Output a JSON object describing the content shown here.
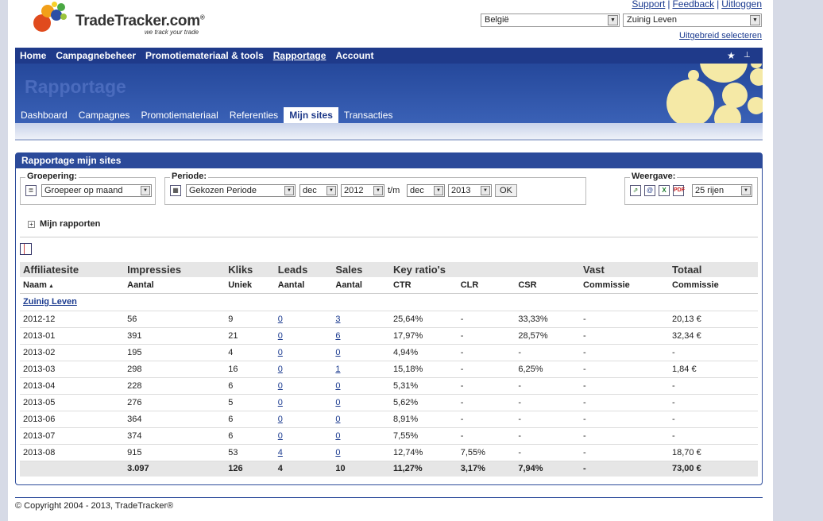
{
  "header": {
    "brand": "TradeTracker.com",
    "registered": "®",
    "tagline": "we track your trade",
    "links": [
      "Support",
      "Feedback",
      "Uitloggen"
    ],
    "country": "België",
    "site": "Zuinig Leven",
    "advanced": "Uitgebreid selecteren"
  },
  "nav": {
    "main": [
      "Home",
      "Campagnebeheer",
      "Promotiemateriaal & tools",
      "Rapportage",
      "Account"
    ],
    "active": "Rapportage",
    "banner_title": "Rapportage",
    "sub": [
      "Dashboard",
      "Campagnes",
      "Promotiemateriaal",
      "Referenties",
      "Mijn sites",
      "Transacties"
    ],
    "sub_active": "Mijn sites"
  },
  "panel": {
    "title": "Rapportage mijn sites",
    "grouping_label": "Groepering:",
    "grouping_value": "Groepeer op maand",
    "period_label": "Periode:",
    "period_value": "Gekozen Periode",
    "from_month": "dec",
    "from_year": "2012",
    "to_label": "t/m",
    "to_month": "dec",
    "to_year": "2013",
    "ok": "OK",
    "view_label": "Weergave:",
    "rows_value": "25 rijen",
    "my_reports": "Mijn rapporten"
  },
  "table": {
    "groups": [
      "Affiliatesite",
      "Impressies",
      "Kliks",
      "Leads",
      "Sales",
      "Key ratio's",
      "",
      "",
      "Vast",
      "Totaal"
    ],
    "columns": [
      "Naam",
      "Aantal",
      "Uniek",
      "Aantal",
      "Aantal",
      "CTR",
      "CLR",
      "CSR",
      "Commissie",
      "Commissie"
    ],
    "sort_mark": "▲",
    "group_name": "Zuinig Leven",
    "rows": [
      [
        "2012-12",
        "56",
        "9",
        "0",
        "3",
        "25,64%",
        "-",
        "33,33%",
        "-",
        "20,13 €"
      ],
      [
        "2013-01",
        "391",
        "21",
        "0",
        "6",
        "17,97%",
        "-",
        "28,57%",
        "-",
        "32,34 €"
      ],
      [
        "2013-02",
        "195",
        "4",
        "0",
        "0",
        "4,94%",
        "-",
        "-",
        "-",
        "-"
      ],
      [
        "2013-03",
        "298",
        "16",
        "0",
        "1",
        "15,18%",
        "-",
        "6,25%",
        "-",
        "1,84 €"
      ],
      [
        "2013-04",
        "228",
        "6",
        "0",
        "0",
        "5,31%",
        "-",
        "-",
        "-",
        "-"
      ],
      [
        "2013-05",
        "276",
        "5",
        "0",
        "0",
        "5,62%",
        "-",
        "-",
        "-",
        "-"
      ],
      [
        "2013-06",
        "364",
        "6",
        "0",
        "0",
        "8,91%",
        "-",
        "-",
        "-",
        "-"
      ],
      [
        "2013-07",
        "374",
        "6",
        "0",
        "0",
        "7,55%",
        "-",
        "-",
        "-",
        "-"
      ],
      [
        "2013-08",
        "915",
        "53",
        "4",
        "0",
        "12,74%",
        "7,55%",
        "-",
        "-",
        "18,70 €"
      ]
    ],
    "totals": [
      "",
      "3.097",
      "126",
      "4",
      "10",
      "11,27%",
      "3,17%",
      "7,94%",
      "-",
      "73,00 €"
    ]
  },
  "footer": "© Copyright 2004 - 2013, TradeTracker®",
  "colors": {
    "nav": "#1f3a8a",
    "panel_head": "#2b4a9a",
    "link": "#1a3a8f"
  }
}
